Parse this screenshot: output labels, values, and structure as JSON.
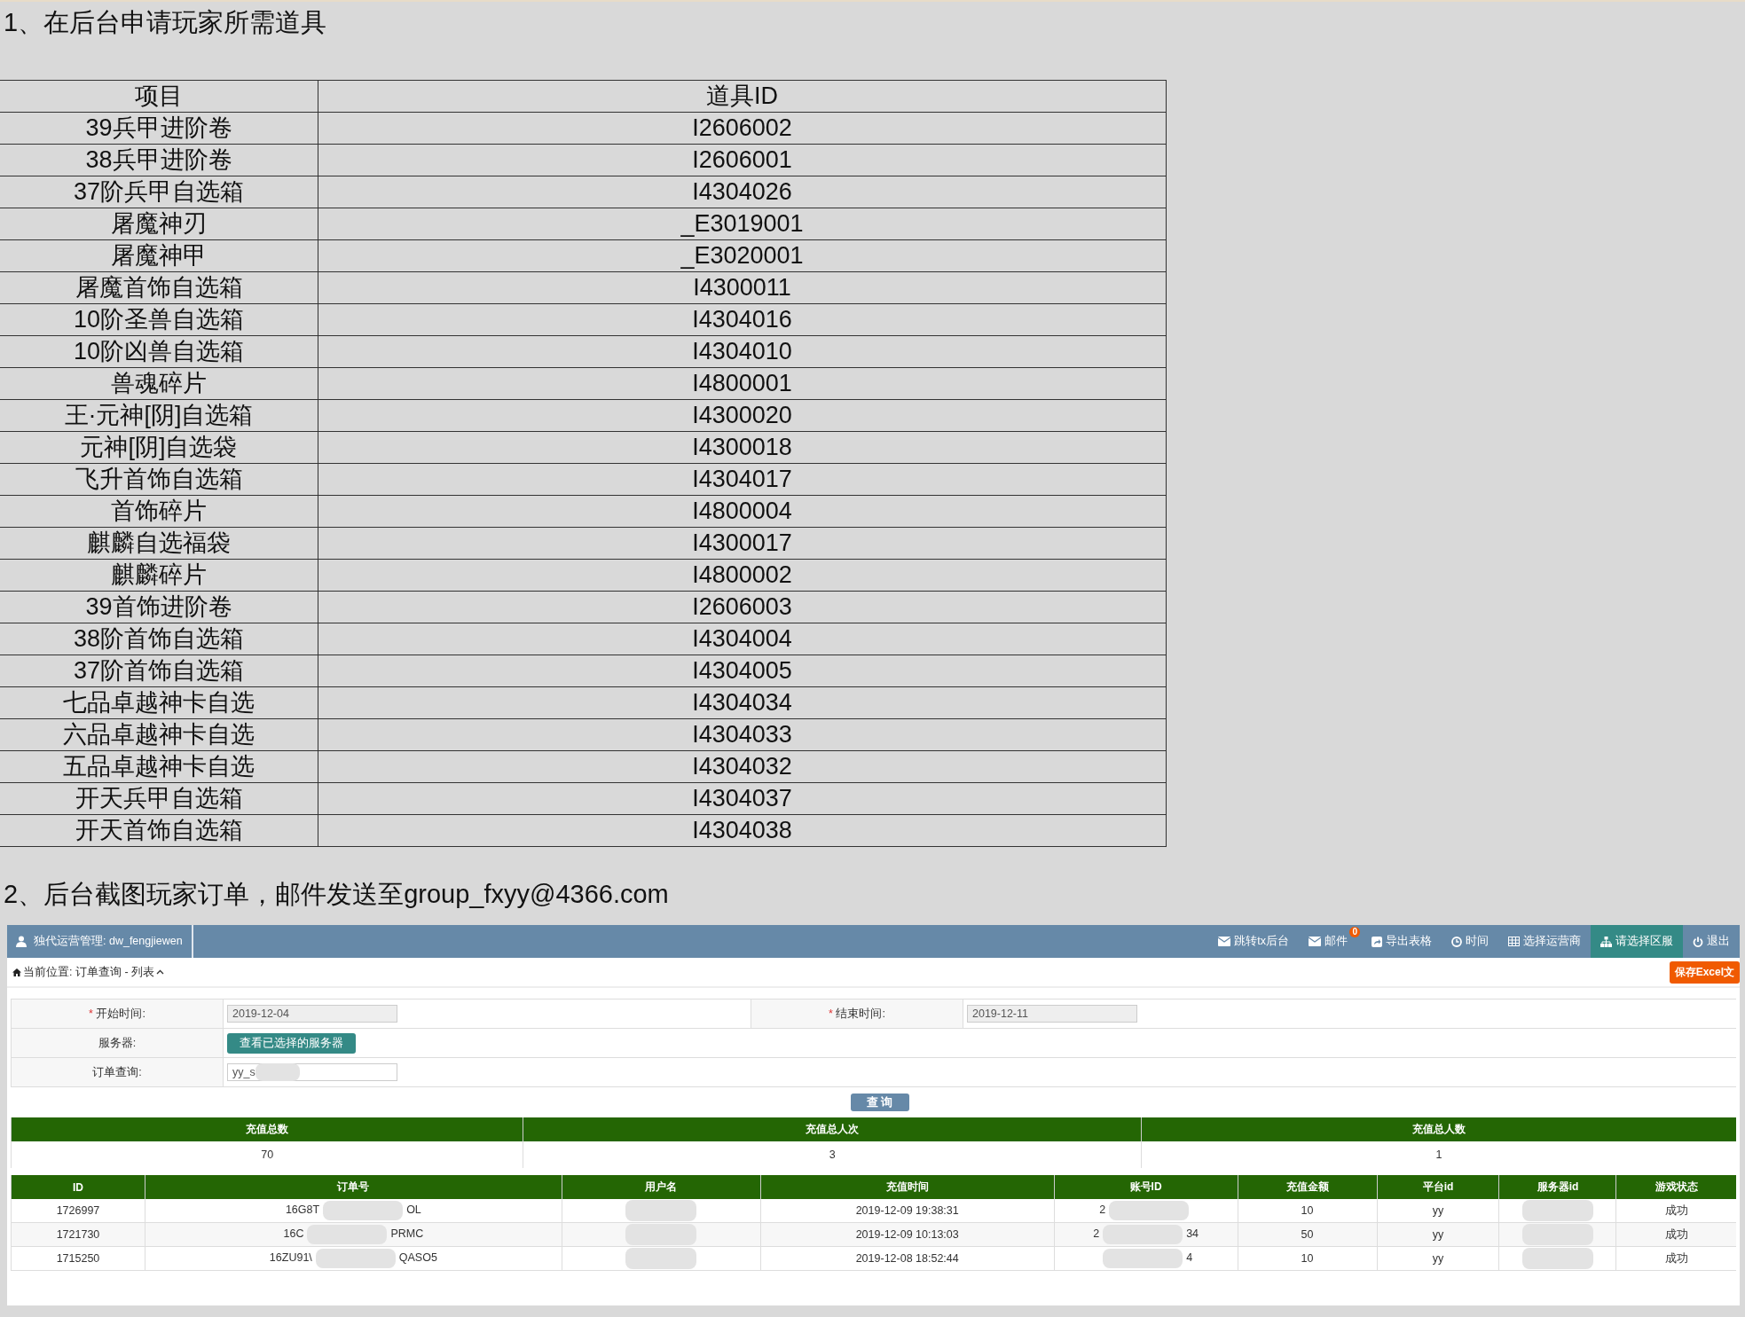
{
  "section_1": {
    "heading": "1、在后台申请玩家所需道具",
    "columns": [
      "项目",
      "道具ID"
    ],
    "rows": [
      [
        "39兵甲进阶卷",
        "I2606002"
      ],
      [
        "38兵甲进阶卷",
        "I2606001"
      ],
      [
        "37阶兵甲自选箱",
        "I4304026"
      ],
      [
        "屠魔神刃",
        "_E3019001"
      ],
      [
        "屠魔神甲",
        "_E3020001"
      ],
      [
        "屠魔首饰自选箱",
        "I4300011"
      ],
      [
        "10阶圣兽自选箱",
        "I4304016"
      ],
      [
        "10阶凶兽自选箱",
        "I4304010"
      ],
      [
        "兽魂碎片",
        "I4800001"
      ],
      [
        "王·元神[阴]自选箱",
        "I4300020"
      ],
      [
        "元神[阴]自选袋",
        "I4300018"
      ],
      [
        "飞升首饰自选箱",
        "I4304017"
      ],
      [
        "首饰碎片",
        "I4800004"
      ],
      [
        "麒麟自选福袋",
        "I4300017"
      ],
      [
        "麒麟碎片",
        "I4800002"
      ],
      [
        "39首饰进阶卷",
        "I2606003"
      ],
      [
        "38阶首饰自选箱",
        "I4304004"
      ],
      [
        "37阶首饰自选箱",
        "I4304005"
      ],
      [
        "七品卓越神卡自选",
        "I4304034"
      ],
      [
        "六品卓越神卡自选",
        "I4304033"
      ],
      [
        "五品卓越神卡自选",
        "I4304032"
      ],
      [
        "开天兵甲自选箱",
        "I4304037"
      ],
      [
        "开天首饰自选箱",
        "I4304038"
      ]
    ]
  },
  "section_2": {
    "heading": "2、后台截图玩家订单，邮件发送至group_fxyy@4366.com",
    "screenshot": {
      "user_label": "独代运营管理: dw_fengjiewen",
      "nav": [
        {
          "label": "跳转tx后台",
          "selected": false
        },
        {
          "label": "邮件",
          "badge": "0",
          "selected": false
        },
        {
          "label": "导出表格",
          "selected": false
        },
        {
          "label": "时间",
          "selected": false
        },
        {
          "label": "选择运营商",
          "selected": false
        },
        {
          "label": "请选择区服",
          "selected": true
        },
        {
          "label": "退出",
          "selected": false
        }
      ],
      "breadcrumb": "当前位置: 订单查询 - 列表",
      "save_button": "保存Excel文",
      "form": {
        "required_mark": "*",
        "start_label": "开始时间:",
        "start_value": "2019-12-04",
        "end_label": "结束时间:",
        "end_value": "2019-12-11",
        "server_label": "服务器:",
        "server_button": "查看已选择的服务器",
        "order_label": "订单查询:",
        "order_value": {
          "visible_start": "yy_s"
        },
        "query_button": "查 询"
      },
      "summary": {
        "columns": [
          "充值总数",
          "充值总人次",
          "充值总人数"
        ],
        "values": [
          "70",
          "3",
          "1"
        ]
      },
      "orders": {
        "columns": [
          "ID",
          "订单号",
          "用户名",
          "充值时间",
          "账号ID",
          "充值金额",
          "平台id",
          "服务器id",
          "游戏状态"
        ],
        "rows": [
          [
            "1726997",
            {
              "visible_start": "16G8T",
              "visible_end": "OL"
            },
            {
              "redacted": true
            },
            "2019-12-09 19:38:31",
            {
              "visible_start": "2"
            },
            "10",
            "yy",
            {
              "redacted": true
            },
            "成功"
          ],
          [
            "1721730",
            {
              "visible_start": "16C",
              "visible_end": "PRMC"
            },
            {
              "redacted": true
            },
            "2019-12-09 10:13:03",
            {
              "visible_start": "2",
              "visible_end": "34"
            },
            "50",
            "yy",
            {
              "redacted": true
            },
            "成功"
          ],
          [
            "1715250",
            {
              "visible_start": "16ZU91\\",
              "visible_end": "QASO5"
            },
            {
              "redacted": true
            },
            "2019-12-08 18:52:44",
            {
              "visible_end": "4"
            },
            "10",
            "yy",
            {
              "redacted": true
            },
            "成功"
          ]
        ]
      }
    }
  }
}
